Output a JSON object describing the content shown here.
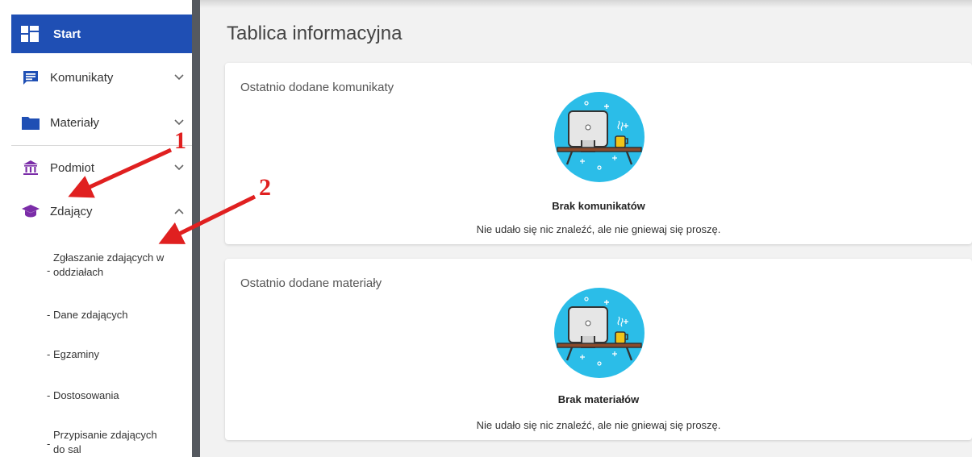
{
  "sidebar": {
    "start_label": "Start",
    "items": [
      {
        "label": "Komunikaty",
        "icon": "message-icon",
        "expanded": false
      },
      {
        "label": "Materiały",
        "icon": "folder-icon",
        "expanded": false
      },
      {
        "label": "Podmiot",
        "icon": "institution-icon",
        "expanded": false
      },
      {
        "label": "Zdający",
        "icon": "graduation-cap-icon",
        "expanded": true
      }
    ],
    "subitems": {
      "zgloszenie_line1": "Zgłaszanie zdających w",
      "zgloszenie_line2": "oddziałach",
      "dane": "- Dane zdających",
      "egzaminy": "- Egzaminy",
      "dostosowania": "- Dostosowania",
      "przypisanie_line1": "Przypisanie zdających",
      "przypisanie_line2": "do sal"
    }
  },
  "main": {
    "title": "Tablica informacyjna",
    "cards": [
      {
        "title": "Ostatnio dodane komunikaty",
        "empty_title": "Brak komunikatów",
        "empty_text": "Nie udało się nic znaleźć, ale nie gniewaj się proszę."
      },
      {
        "title": "Ostatnio dodane materiały",
        "empty_title": "Brak materiałów",
        "empty_text": "Nie udało się nic znaleźć, ale nie gniewaj się proszę."
      }
    ]
  },
  "annotations": {
    "one": "1",
    "two": "2"
  },
  "colors": {
    "accent": "#1f4fb4",
    "nav_icon_blue": "#1f4fb4",
    "nav_icon_purple": "#7b2da8",
    "annotation_red": "#e02020",
    "illustration_bg": "#2bbde8"
  }
}
